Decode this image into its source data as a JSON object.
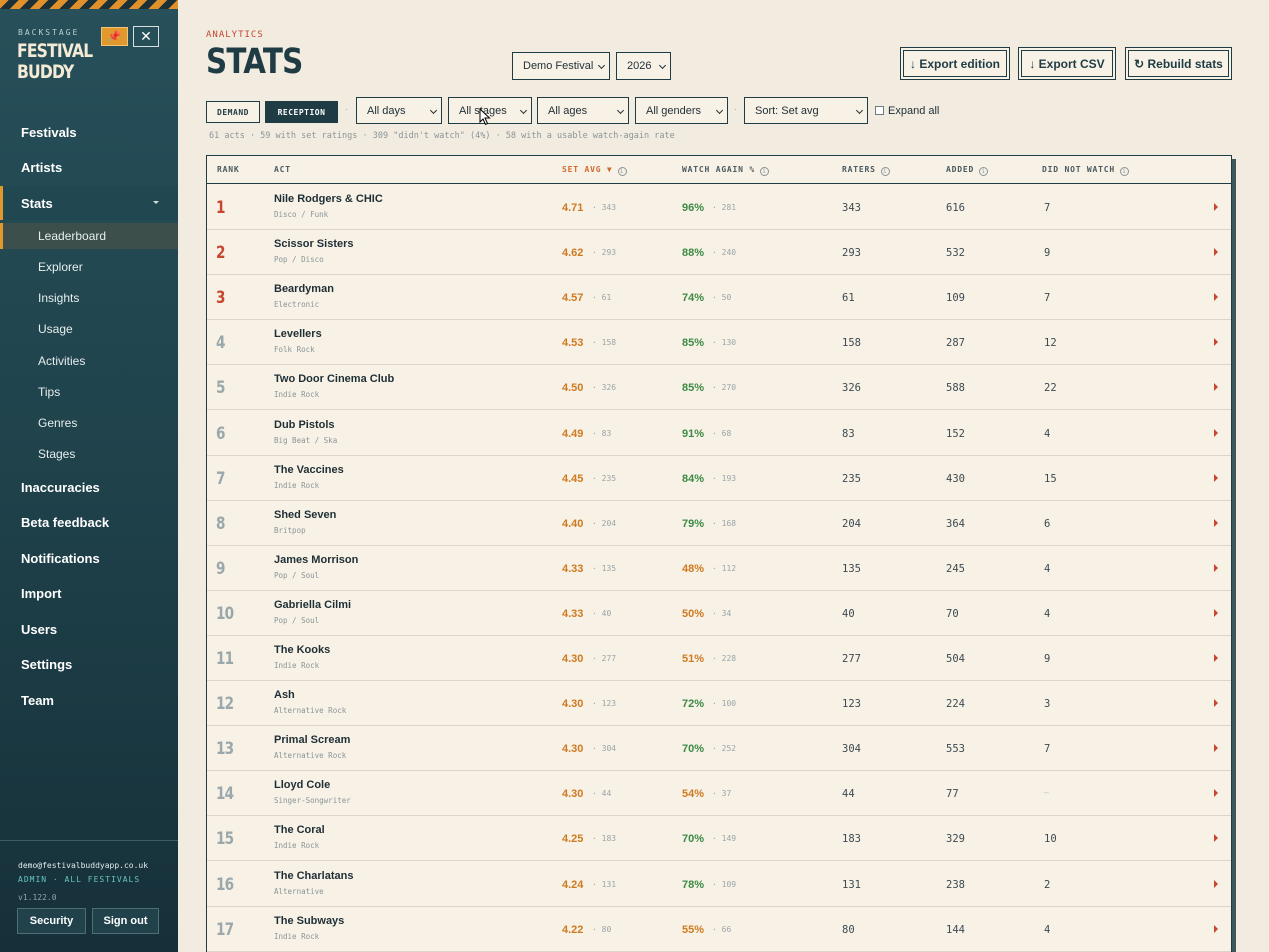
{
  "sidebar": {
    "brand_sub": "BACKSTAGE",
    "brand_line1": "FESTIVAL",
    "brand_line2": "BUDDY",
    "pin_icon": "📌",
    "close_icon": "✕",
    "nav": [
      {
        "label": "Festivals"
      },
      {
        "label": "Artists"
      },
      {
        "label": "Stats"
      }
    ],
    "sub": [
      {
        "label": "Leaderboard"
      },
      {
        "label": "Explorer"
      },
      {
        "label": "Insights"
      },
      {
        "label": "Usage"
      },
      {
        "label": "Activities"
      },
      {
        "label": "Tips"
      },
      {
        "label": "Genres"
      },
      {
        "label": "Stages"
      }
    ],
    "nav2": [
      {
        "label": "Inaccuracies"
      },
      {
        "label": "Beta feedback"
      },
      {
        "label": "Notifications"
      },
      {
        "label": "Import"
      },
      {
        "label": "Users"
      },
      {
        "label": "Settings"
      },
      {
        "label": "Team"
      }
    ],
    "email": "demo@festivalbuddyapp.co.uk",
    "role": "ADMIN · ALL FESTIVALS",
    "version": "v1.122.0",
    "security_label": "Security",
    "signout_label": "Sign out"
  },
  "header": {
    "eyebrow": "ANALYTICS",
    "title": "STATS",
    "festival_select": "Demo Festival",
    "year_select": "2026",
    "export_edition": "↓ Export edition",
    "export_csv": "↓ Export CSV",
    "rebuild": "↻ Rebuild stats"
  },
  "filters": {
    "demand": "DEMAND",
    "reception": "RECEPTION",
    "days": "All days",
    "stages": "All stages",
    "ages": "All ages",
    "genders": "All genders",
    "sort": "Sort: Set avg",
    "expand_all": "Expand all",
    "separator": "·"
  },
  "summary": "61 acts · 59 with set ratings · 309 \"didn't watch\" (4%) · 58 with a usable watch-again rate",
  "table": {
    "columns": {
      "rank": "RANK",
      "act": "ACT",
      "set_avg": "SET AVG ▼",
      "watch_again": "WATCH AGAIN %",
      "raters": "RATERS",
      "added": "ADDED",
      "did_not_watch": "DID NOT WATCH"
    },
    "info_icon": "i",
    "rows": [
      {
        "rank": "1",
        "act": "Nile Rodgers & CHIC",
        "genre": "Disco / Funk",
        "avg": "4.71",
        "avg_n": "· 343",
        "wa": "96%",
        "wa_n": "· 281",
        "raters": "343",
        "added": "616",
        "dnw": "7"
      },
      {
        "rank": "2",
        "act": "Scissor Sisters",
        "genre": "Pop / Disco",
        "avg": "4.62",
        "avg_n": "· 293",
        "wa": "88%",
        "wa_n": "· 240",
        "raters": "293",
        "added": "532",
        "dnw": "9"
      },
      {
        "rank": "3",
        "act": "Beardyman",
        "genre": "Electronic",
        "avg": "4.57",
        "avg_n": "· 61",
        "wa": "74%",
        "wa_n": "· 50",
        "raters": "61",
        "added": "109",
        "dnw": "7"
      },
      {
        "rank": "4",
        "act": "Levellers",
        "genre": "Folk Rock",
        "avg": "4.53",
        "avg_n": "· 158",
        "wa": "85%",
        "wa_n": "· 130",
        "raters": "158",
        "added": "287",
        "dnw": "12"
      },
      {
        "rank": "5",
        "act": "Two Door Cinema Club",
        "genre": "Indie Rock",
        "avg": "4.50",
        "avg_n": "· 326",
        "wa": "85%",
        "wa_n": "· 270",
        "raters": "326",
        "added": "588",
        "dnw": "22"
      },
      {
        "rank": "6",
        "act": "Dub Pistols",
        "genre": "Big Beat / Ska",
        "avg": "4.49",
        "avg_n": "· 83",
        "wa": "91%",
        "wa_n": "· 68",
        "raters": "83",
        "added": "152",
        "dnw": "4"
      },
      {
        "rank": "7",
        "act": "The Vaccines",
        "genre": "Indie Rock",
        "avg": "4.45",
        "avg_n": "· 235",
        "wa": "84%",
        "wa_n": "· 193",
        "raters": "235",
        "added": "430",
        "dnw": "15"
      },
      {
        "rank": "8",
        "act": "Shed Seven",
        "genre": "Britpop",
        "avg": "4.40",
        "avg_n": "· 204",
        "wa": "79%",
        "wa_n": "· 168",
        "raters": "204",
        "added": "364",
        "dnw": "6"
      },
      {
        "rank": "9",
        "act": "James Morrison",
        "genre": "Pop / Soul",
        "avg": "4.33",
        "avg_n": "· 135",
        "wa": "48%",
        "wa_n": "· 112",
        "raters": "135",
        "added": "245",
        "dnw": "4"
      },
      {
        "rank": "10",
        "act": "Gabriella Cilmi",
        "genre": "Pop / Soul",
        "avg": "4.33",
        "avg_n": "· 40",
        "wa": "50%",
        "wa_n": "· 34",
        "raters": "40",
        "added": "70",
        "dnw": "4"
      },
      {
        "rank": "11",
        "act": "The Kooks",
        "genre": "Indie Rock",
        "avg": "4.30",
        "avg_n": "· 277",
        "wa": "51%",
        "wa_n": "· 228",
        "raters": "277",
        "added": "504",
        "dnw": "9"
      },
      {
        "rank": "12",
        "act": "Ash",
        "genre": "Alternative Rock",
        "avg": "4.30",
        "avg_n": "· 123",
        "wa": "72%",
        "wa_n": "· 100",
        "raters": "123",
        "added": "224",
        "dnw": "3"
      },
      {
        "rank": "13",
        "act": "Primal Scream",
        "genre": "Alternative Rock",
        "avg": "4.30",
        "avg_n": "· 304",
        "wa": "70%",
        "wa_n": "· 252",
        "raters": "304",
        "added": "553",
        "dnw": "7"
      },
      {
        "rank": "14",
        "act": "Lloyd Cole",
        "genre": "Singer-Songwriter",
        "avg": "4.30",
        "avg_n": "· 44",
        "wa": "54%",
        "wa_n": "· 37",
        "raters": "44",
        "added": "77",
        "dnw": "—"
      },
      {
        "rank": "15",
        "act": "The Coral",
        "genre": "Indie Rock",
        "avg": "4.25",
        "avg_n": "· 183",
        "wa": "70%",
        "wa_n": "· 149",
        "raters": "183",
        "added": "329",
        "dnw": "10"
      },
      {
        "rank": "16",
        "act": "The Charlatans",
        "genre": "Alternative",
        "avg": "4.24",
        "avg_n": "· 131",
        "wa": "78%",
        "wa_n": "· 109",
        "raters": "131",
        "added": "238",
        "dnw": "2"
      },
      {
        "rank": "17",
        "act": "The Subways",
        "genre": "Indie Rock",
        "avg": "4.22",
        "avg_n": "· 80",
        "wa": "55%",
        "wa_n": "· 66",
        "raters": "80",
        "added": "144",
        "dnw": "4"
      }
    ]
  },
  "colors": {
    "watch_high": "#3d8a45",
    "watch_low": "#cf7a20",
    "accent": "#c6462f"
  }
}
